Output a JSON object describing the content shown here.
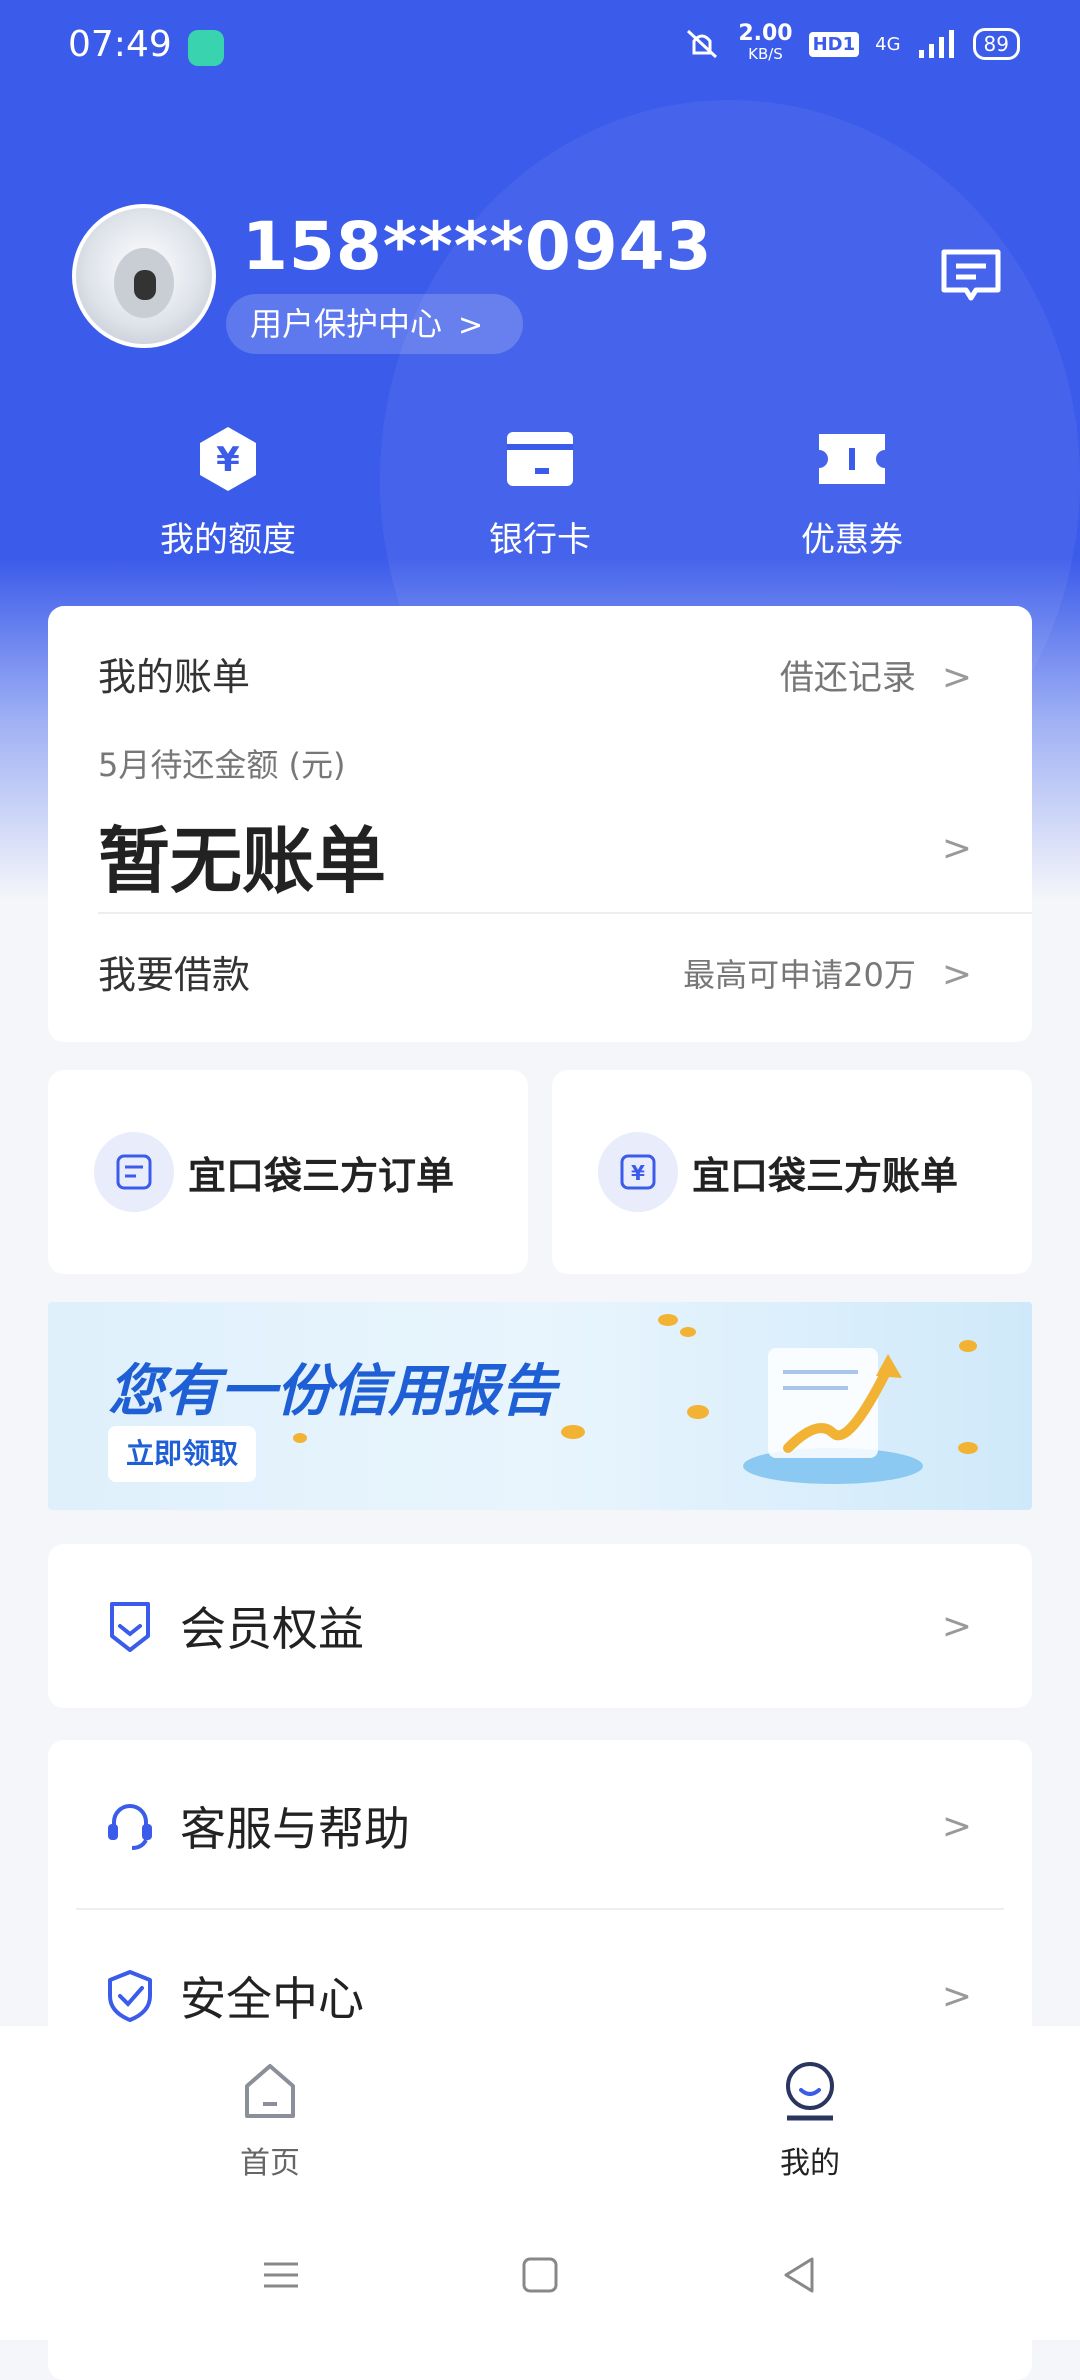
{
  "status_bar": {
    "time": "07:49",
    "speed_value": "2.00",
    "speed_unit": "KB/S",
    "hd_label": "HD1",
    "network": "4G",
    "battery": "89"
  },
  "profile": {
    "phone": "158****0943",
    "protect_label": "用户保护中心"
  },
  "quick_actions": [
    {
      "label": "我的额度",
      "icon": "yuan-hexagon-icon"
    },
    {
      "label": "银行卡",
      "icon": "bank-card-icon"
    },
    {
      "label": "优惠券",
      "icon": "coupon-icon"
    }
  ],
  "bill": {
    "title": "我的账单",
    "record_link": "借还记录",
    "month_label": "5月待还金额 (元)",
    "amount_text": "暂无账单",
    "borrow_label": "我要借款",
    "borrow_limit": "最高可申请20万"
  },
  "third_party": [
    {
      "label": "宜口袋三方订单",
      "icon": "order-icon"
    },
    {
      "label": "宜口袋三方账单",
      "icon": "yuan-bill-icon"
    }
  ],
  "banner": {
    "title": "您有一份信用报告",
    "button": "立即领取"
  },
  "menu": {
    "member": "会员权益",
    "help": "客服与帮助",
    "security": "安全中心"
  },
  "tabs": [
    {
      "label": "首页",
      "icon": "home-icon",
      "active": false
    },
    {
      "label": "我的",
      "icon": "profile-icon",
      "active": true
    }
  ],
  "colors": {
    "brand_blue": "#3b5bea",
    "banner_blue": "#1f5fd6"
  }
}
